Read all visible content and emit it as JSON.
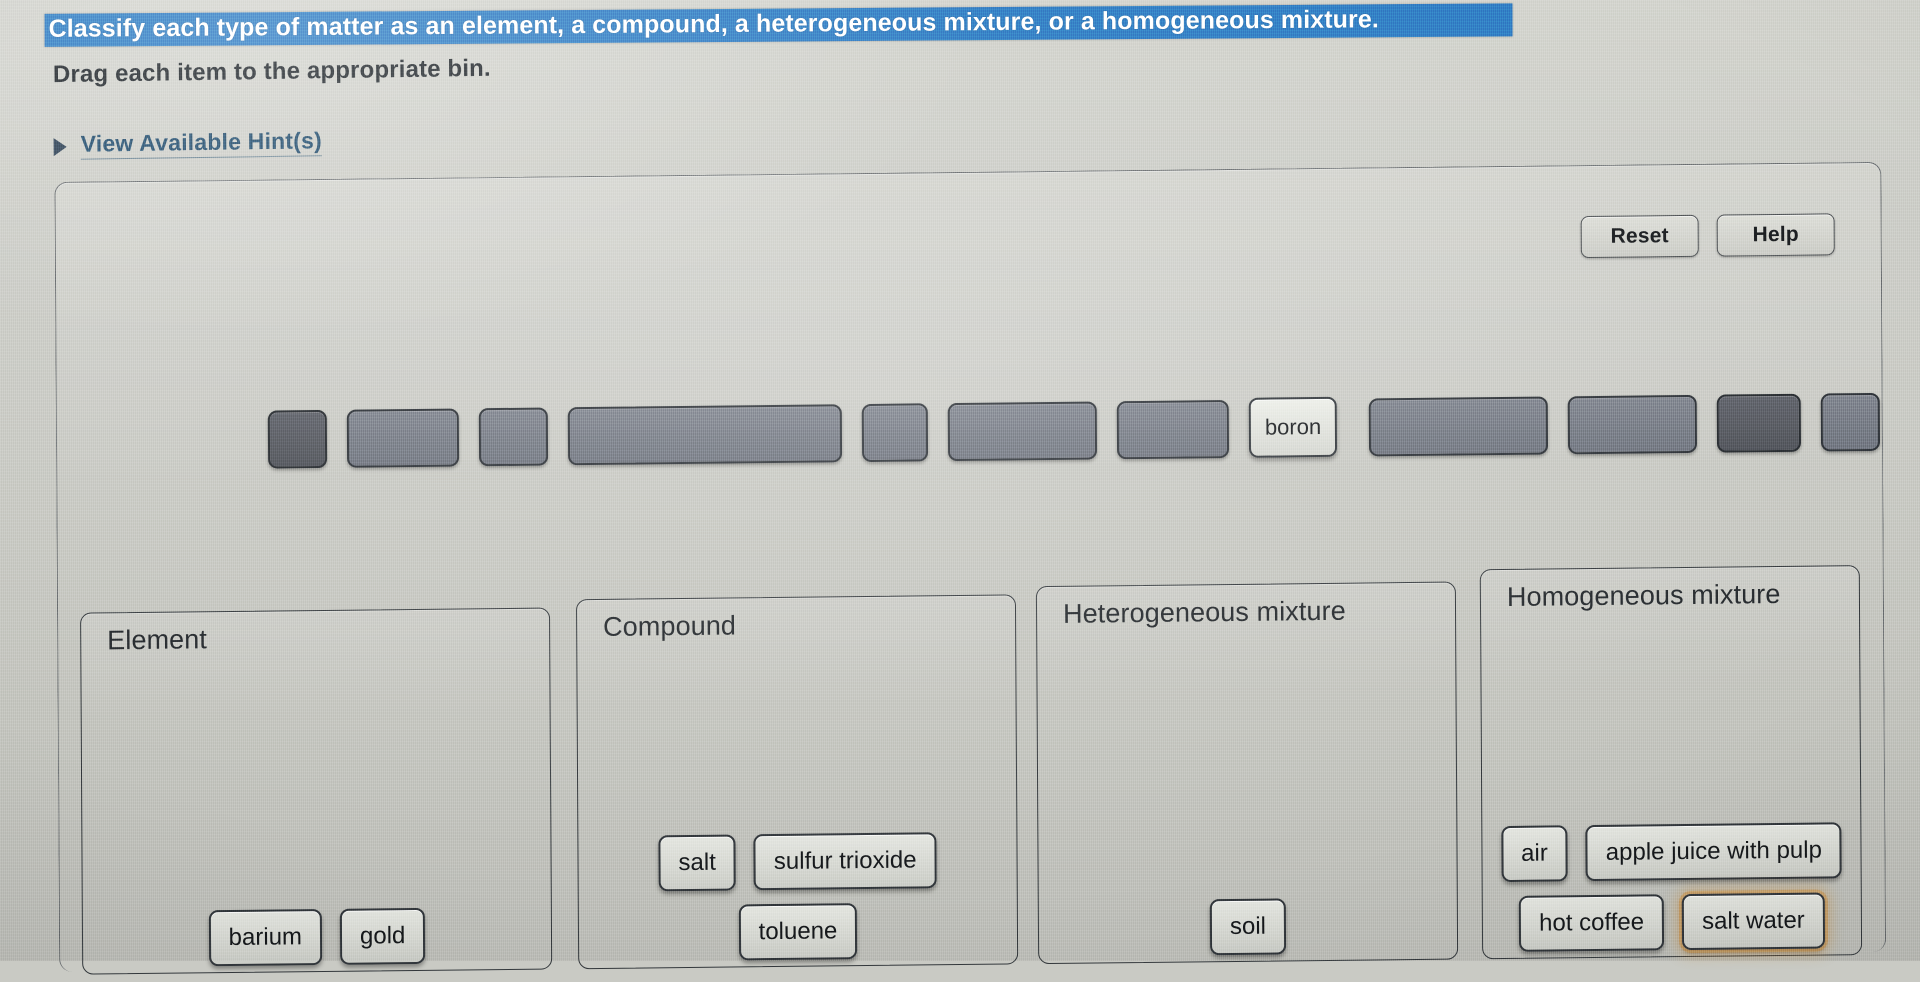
{
  "question": {
    "title": "Classify each type of matter as an element, a compound, a heterogeneous mixture, or a homogeneous mixture.",
    "instruction": "Drag each item to the appropriate bin.",
    "hints_label": "View Available Hint(s)",
    "hints_icon": "triangle-right-icon"
  },
  "toolbar": {
    "reset_label": "Reset",
    "help_label": "Help"
  },
  "tray": {
    "remaining_items": [
      "boron"
    ],
    "empty_slots": 11,
    "slot_widths": [
      55,
      108,
      65,
      270,
      62,
      145,
      108,
      175,
      125,
      80
    ]
  },
  "bins": [
    {
      "id": "element",
      "label": "Element",
      "items": [
        {
          "label": "barium",
          "highlight": false
        },
        {
          "label": "gold",
          "highlight": false
        }
      ]
    },
    {
      "id": "compound",
      "label": "Compound",
      "items": [
        {
          "label": "salt",
          "highlight": false
        },
        {
          "label": "sulfur trioxide",
          "highlight": false
        },
        {
          "label": "toluene",
          "highlight": false
        }
      ]
    },
    {
      "id": "heterogeneous-mixture",
      "label": "Heterogeneous mixture",
      "items": [
        {
          "label": "soil",
          "highlight": false
        }
      ]
    },
    {
      "id": "homogeneous-mixture",
      "label": "Homogeneous mixture",
      "items": [
        {
          "label": "air",
          "highlight": false
        },
        {
          "label": "apple juice with pulp",
          "highlight": false
        },
        {
          "label": "hot coffee",
          "highlight": false
        },
        {
          "label": "salt water",
          "highlight": true
        }
      ]
    }
  ],
  "colors": {
    "selection_highlight": "#2f7dc4",
    "link_text": "#1f4a6b",
    "page_background": "#c9cac4",
    "chip_face": "#dcded8",
    "empty_slot": "#787d87",
    "focus_glow": "#cb9246"
  }
}
